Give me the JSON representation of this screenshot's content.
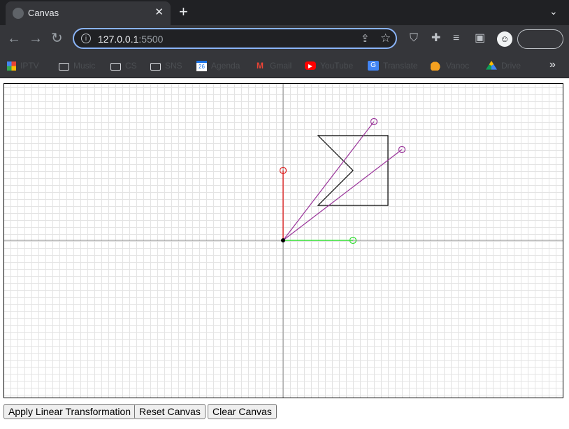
{
  "browser": {
    "tab": {
      "title": "Canvas",
      "close_glyph": "✕"
    },
    "new_tab_glyph": "+",
    "tab_menu_glyph": "⌄",
    "omnibox": {
      "url_host": "127.0.0.1",
      "url_port": ":5500",
      "info_glyph": "i"
    },
    "bookmarks": [
      {
        "label": "IPTV",
        "icon": "apps-icon"
      },
      {
        "label": "Music",
        "icon": "folder-icon"
      },
      {
        "label": "CS",
        "icon": "folder-icon"
      },
      {
        "label": "SNS",
        "icon": "folder-icon"
      },
      {
        "label": "Agenda",
        "icon": "calendar-icon",
        "glyph": "26"
      },
      {
        "label": "Gmail",
        "icon": "gmail-icon"
      },
      {
        "label": "YouTube",
        "icon": "youtube-icon"
      },
      {
        "label": "Translate",
        "icon": "translate-icon"
      },
      {
        "label": "Vanoc",
        "icon": "fruit-icon"
      },
      {
        "label": "Drive",
        "icon": "drive-icon"
      }
    ],
    "bookmarks_more_glyph": "»"
  },
  "buttons": {
    "apply": "Apply Linear Transformation",
    "reset": "Reset Canvas",
    "clear": "Clear Canvas"
  },
  "colors": {
    "basis_i": "#33dd33",
    "basis_j": "#dd2222",
    "transformed_vectors": "#993399",
    "shape": "#000000",
    "grid": "#e4e4e4",
    "axes": "#888888"
  },
  "canvas_scene": {
    "units_per_grid_square": 1,
    "origin": [
      0,
      0
    ],
    "basis_i": [
      10,
      0
    ],
    "basis_j": [
      0,
      10
    ],
    "transformed_vectors": [
      [
        13,
        17
      ],
      [
        17,
        13
      ]
    ],
    "shape_polygon": [
      [
        5,
        15
      ],
      [
        15,
        15
      ],
      [
        15,
        5
      ],
      [
        5,
        5
      ],
      [
        10,
        10
      ]
    ]
  }
}
